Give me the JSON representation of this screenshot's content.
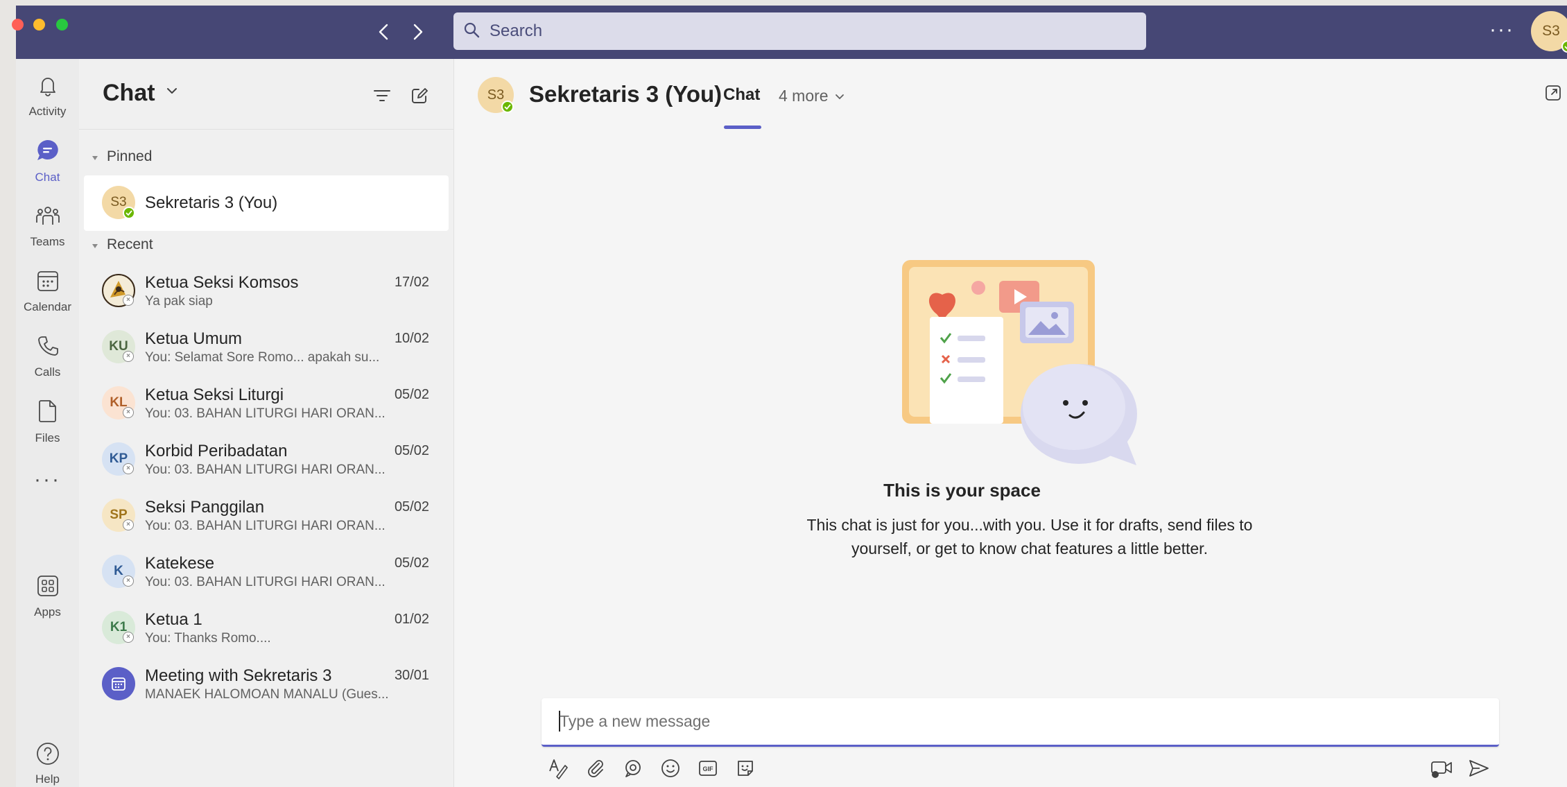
{
  "window": {
    "search_placeholder": "Search",
    "more_label": "···",
    "me_initials": "S3"
  },
  "rail": {
    "items": [
      {
        "label": "Activity",
        "icon": "bell-icon"
      },
      {
        "label": "Chat",
        "icon": "chat-icon",
        "active": true
      },
      {
        "label": "Teams",
        "icon": "teams-icon"
      },
      {
        "label": "Calendar",
        "icon": "calendar-icon"
      },
      {
        "label": "Calls",
        "icon": "phone-icon"
      },
      {
        "label": "Files",
        "icon": "file-icon"
      },
      {
        "label": "Apps",
        "icon": "apps-icon"
      }
    ],
    "more_label": "···",
    "help_label": "Help"
  },
  "chat_list": {
    "title": "Chat",
    "pinned_label": "Pinned",
    "recent_label": "Recent",
    "pinned": [
      {
        "initials": "S3",
        "name": "Sekretaris 3 (You)"
      }
    ],
    "recent": [
      {
        "initials": "",
        "name": "Ketua Seksi Komsos",
        "date": "17/02",
        "preview": "Ya pak siap"
      },
      {
        "initials": "KU",
        "name": "Ketua Umum",
        "date": "10/02",
        "preview": "You: Selamat Sore Romo... apakah su..."
      },
      {
        "initials": "KL",
        "name": "Ketua Seksi Liturgi",
        "date": "05/02",
        "preview": "You: 03. BAHAN LITURGI HARI ORAN..."
      },
      {
        "initials": "KP",
        "name": "Korbid Peribadatan",
        "date": "05/02",
        "preview": "You: 03. BAHAN LITURGI HARI ORAN..."
      },
      {
        "initials": "SP",
        "name": "Seksi Panggilan",
        "date": "05/02",
        "preview": "You: 03. BAHAN LITURGI HARI ORAN..."
      },
      {
        "initials": "K",
        "name": "Katekese",
        "date": "05/02",
        "preview": "You: 03. BAHAN LITURGI HARI ORAN..."
      },
      {
        "initials": "K1",
        "name": "Ketua 1",
        "date": "01/02",
        "preview": "You: Thanks Romo...."
      },
      {
        "initials": "",
        "name": "Meeting with Sekretaris 3",
        "date": "30/01",
        "preview": "MANAEK HALOMOAN MANALU (Gues..."
      }
    ]
  },
  "main": {
    "avatar_initials": "S3",
    "title": "Sekretaris 3 (You)",
    "tab_chat": "Chat",
    "tab_more": "4 more",
    "space_title": "This is your space",
    "space_desc": "This chat is just for you...with you. Use it for drafts, send files to yourself, or get to know chat features a little better.",
    "composer_placeholder": "Type a new message"
  },
  "colors": {
    "titlebar": "#464775",
    "accent": "#5b5fc7",
    "presence_available": "#6bb700"
  }
}
